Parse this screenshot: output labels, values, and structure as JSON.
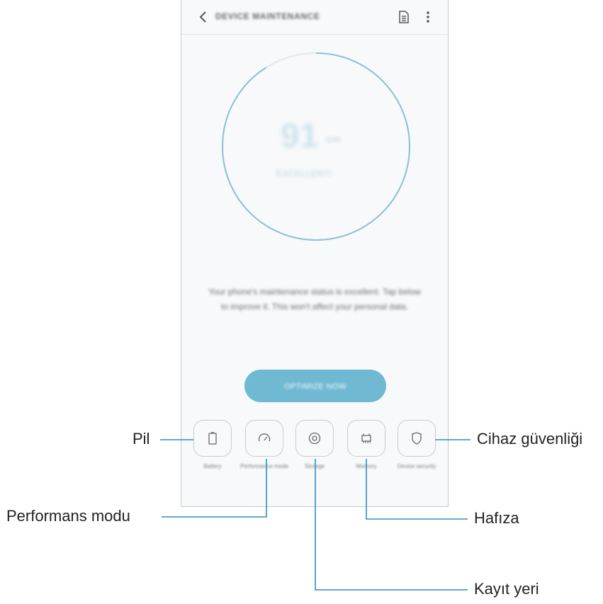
{
  "appbar": {
    "title": "DEVICE MAINTENANCE",
    "icons": [
      "back-icon",
      "report-icon",
      "more-icon"
    ]
  },
  "score": {
    "value": "91",
    "unit": "/100",
    "status": "EXCELLENT!"
  },
  "description": "Your phone's maintenance status is excellent. Tap below to improve it. This won't affect your personal data.",
  "optimize_button": "OPTIMIZE NOW",
  "tiles": [
    {
      "icon": "battery-icon",
      "label": "Battery",
      "status": ""
    },
    {
      "icon": "speedometer-icon",
      "label": "Performance mode",
      "status": ""
    },
    {
      "icon": "storage-icon",
      "label": "Storage",
      "status": ""
    },
    {
      "icon": "memory-chip-icon",
      "label": "Memory",
      "status": ""
    },
    {
      "icon": "shield-icon",
      "label": "Device security",
      "status": ""
    }
  ],
  "callouts": {
    "pil": "Pil",
    "performans": "Performans modu",
    "kayit": "Kayıt yeri",
    "hafiza": "Hafıza",
    "guvenlik": "Cihaz güvenliği"
  },
  "colors": {
    "accent": "#6fb9d2",
    "ring": "#8fc0d6",
    "leader": "#2d8fc7"
  }
}
